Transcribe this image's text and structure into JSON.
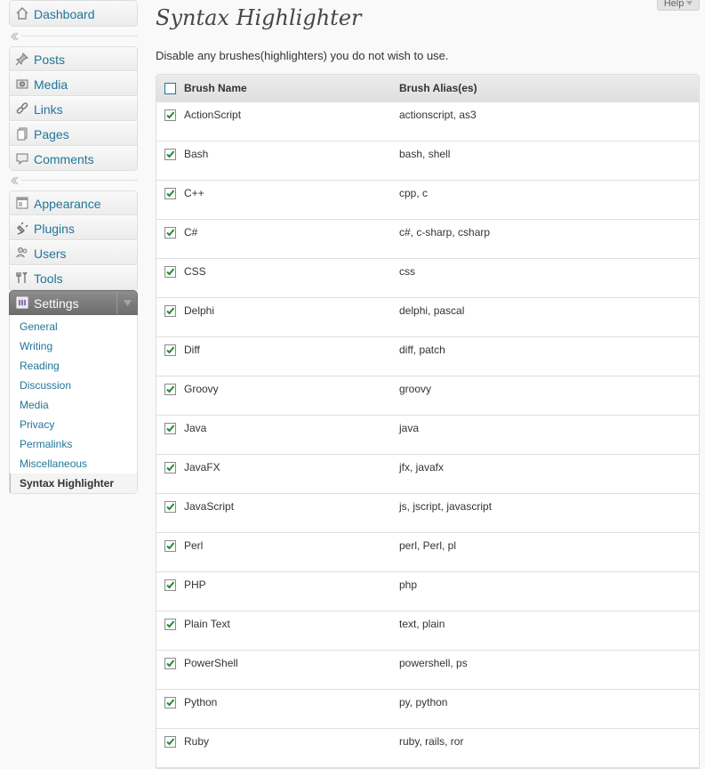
{
  "help_label": "Help",
  "page_title": "Syntax Highlighter",
  "intro": "Disable any brushes(highlighters) you do not wish to use.",
  "menu": {
    "dashboard": "Dashboard",
    "group1": [
      "Posts",
      "Media",
      "Links",
      "Pages",
      "Comments"
    ],
    "group2": [
      "Appearance",
      "Plugins",
      "Users",
      "Tools"
    ],
    "settings": "Settings",
    "settings_sub": [
      "General",
      "Writing",
      "Reading",
      "Discussion",
      "Media",
      "Privacy",
      "Permalinks",
      "Miscellaneous",
      "Syntax Highlighter"
    ]
  },
  "table": {
    "headers": {
      "name": "Brush Name",
      "alias": "Brush Alias(es)"
    },
    "rows": [
      {
        "name": "ActionScript",
        "alias": "actionscript, as3"
      },
      {
        "name": "Bash",
        "alias": "bash, shell"
      },
      {
        "name": "C++",
        "alias": "cpp, c"
      },
      {
        "name": "C#",
        "alias": "c#, c-sharp, csharp"
      },
      {
        "name": "CSS",
        "alias": "css"
      },
      {
        "name": "Delphi",
        "alias": "delphi, pascal"
      },
      {
        "name": "Diff",
        "alias": "diff, patch"
      },
      {
        "name": "Groovy",
        "alias": "groovy"
      },
      {
        "name": "Java",
        "alias": "java"
      },
      {
        "name": "JavaFX",
        "alias": "jfx, javafx"
      },
      {
        "name": "JavaScript",
        "alias": "js, jscript, javascript"
      },
      {
        "name": "Perl",
        "alias": "perl, Perl, pl"
      },
      {
        "name": "PHP",
        "alias": "php"
      },
      {
        "name": "Plain Text",
        "alias": "text, plain"
      },
      {
        "name": "PowerShell",
        "alias": "powershell, ps"
      },
      {
        "name": "Python",
        "alias": "py, python"
      },
      {
        "name": "Ruby",
        "alias": "ruby, rails, ror"
      }
    ]
  },
  "colors": {
    "link": "#21759b",
    "check": "#1f8c2e",
    "settings_bg": "#7d7d7d"
  }
}
